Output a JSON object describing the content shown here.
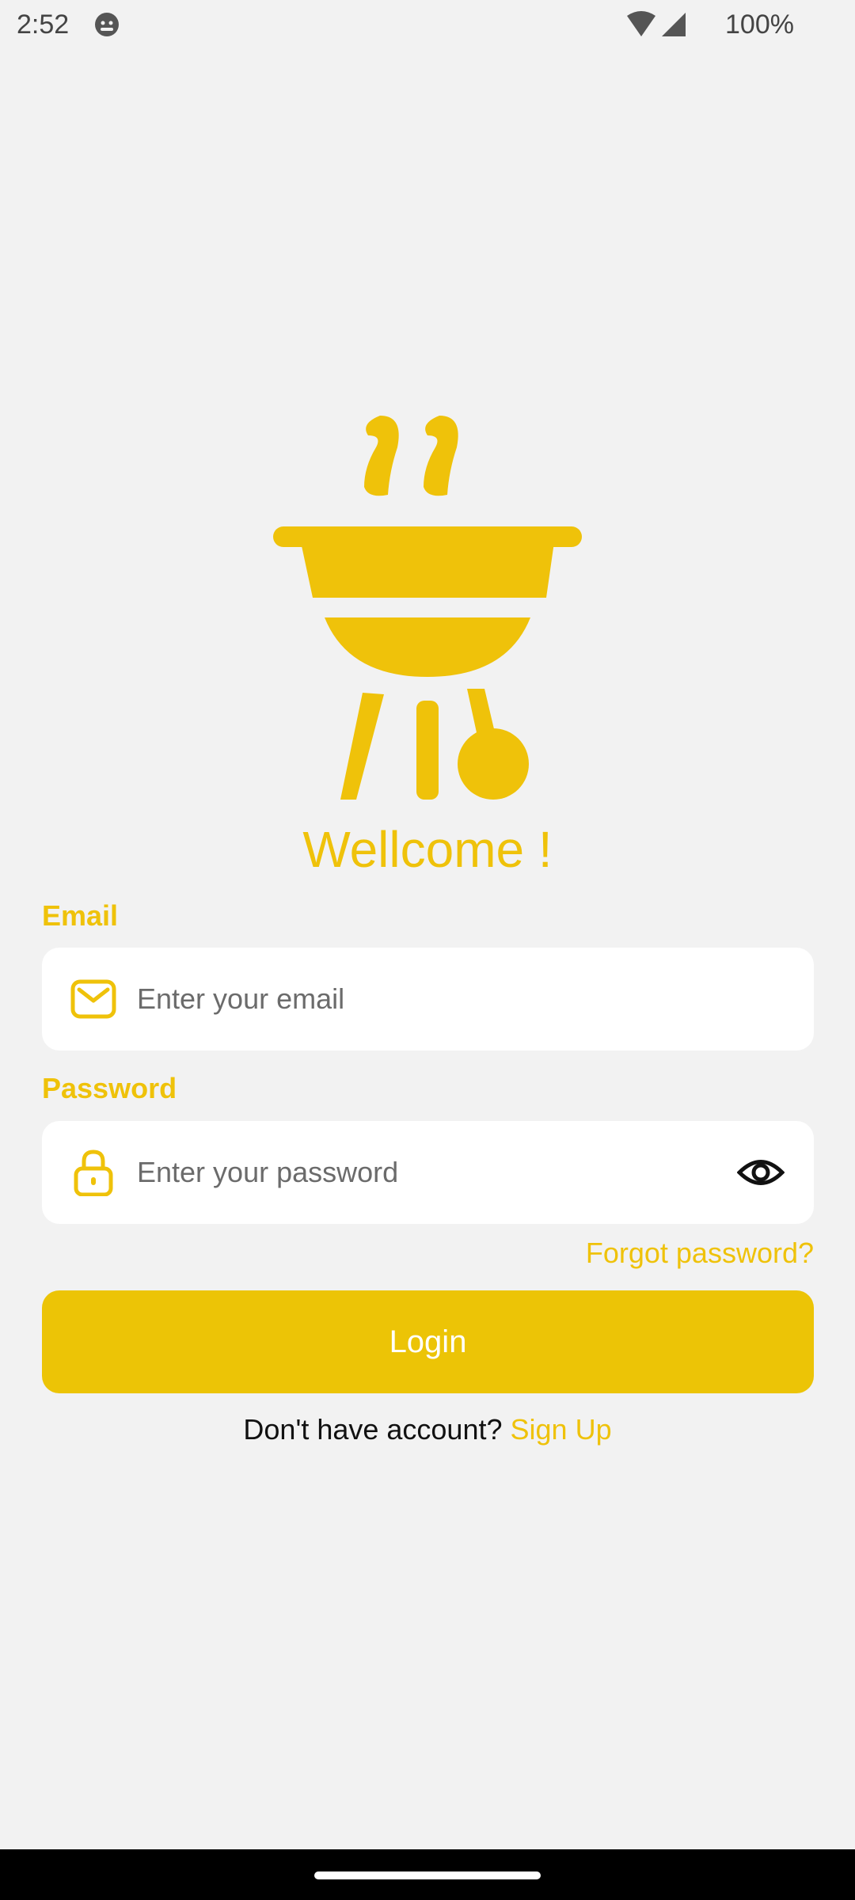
{
  "status_bar": {
    "time": "2:52",
    "battery": "100%",
    "icons": [
      "android-face-icon",
      "wifi-icon",
      "signal-icon"
    ]
  },
  "logo": {
    "icon": "grill-icon",
    "color": "#efc20a"
  },
  "welcome": "Wellcome !",
  "form": {
    "email_label": "Email",
    "email_placeholder": "Enter your email",
    "email_icon": "mail-icon",
    "password_label": "Password",
    "password_placeholder": "Enter your password",
    "password_icon": "lock-icon",
    "toggle_icon": "eye-icon",
    "forgot": "Forgot password?",
    "login": "Login"
  },
  "signup": {
    "prompt": "Don't have account?",
    "link": "Sign Up"
  },
  "colors": {
    "accent": "#efc20a",
    "button": "#ecc406",
    "background": "#f2f2f2"
  }
}
